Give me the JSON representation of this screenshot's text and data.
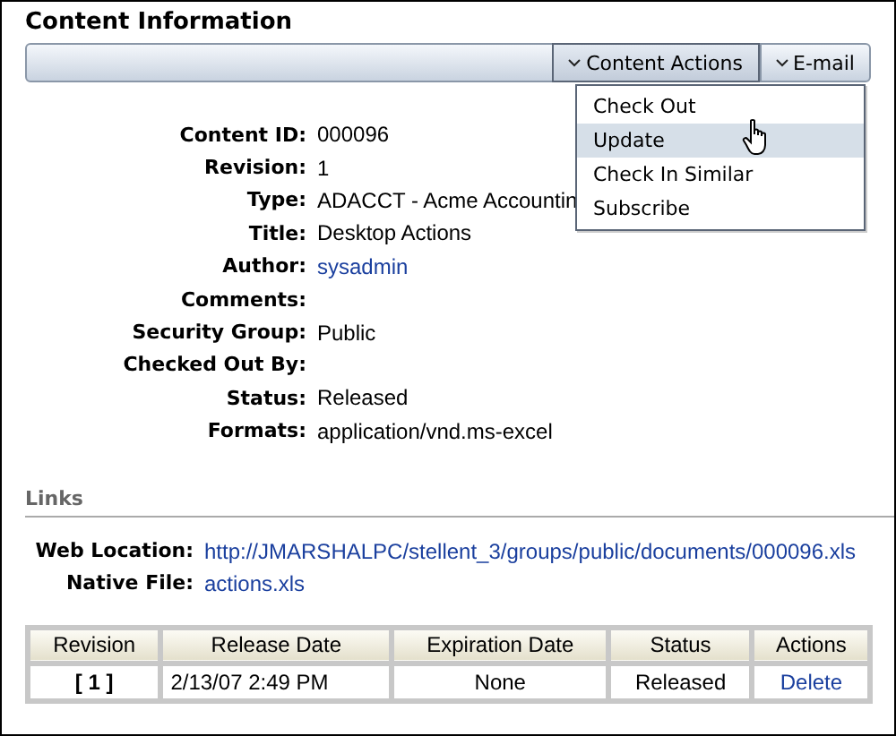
{
  "title": "Content Information",
  "toolbar": {
    "buttons": [
      {
        "label": "Content Actions",
        "selected": true
      },
      {
        "label": "E-mail",
        "selected": false
      }
    ]
  },
  "menu": {
    "items": [
      {
        "label": "Check Out",
        "selected": false
      },
      {
        "label": "Update",
        "selected": true
      },
      {
        "label": "Check In Similar",
        "selected": false
      },
      {
        "label": "Subscribe",
        "selected": false
      }
    ]
  },
  "fields": [
    {
      "label": "Content ID:",
      "value": "000096",
      "kind": "text"
    },
    {
      "label": "Revision:",
      "value": "1",
      "kind": "text"
    },
    {
      "label": "Type:",
      "value": "ADACCT - Acme Accountin",
      "kind": "text"
    },
    {
      "label": "Title:",
      "value": "Desktop Actions",
      "kind": "text"
    },
    {
      "label": "Author:",
      "value": "sysadmin",
      "kind": "link"
    },
    {
      "label": "Comments:"
    },
    {
      "label": "Security Group:",
      "value": "Public",
      "kind": "text"
    },
    {
      "label": "Checked Out By:"
    },
    {
      "label": "Status:",
      "value": "Released",
      "kind": "text"
    },
    {
      "label": "Formats:",
      "value": "application/vnd.ms-excel",
      "kind": "text"
    }
  ],
  "links": {
    "heading": "Links",
    "items": [
      {
        "label": "Web Location:",
        "value": "http://JMARSHALPC/stellent_3/groups/public/documents/000096.xls"
      },
      {
        "label": "Native File:",
        "value": "actions.xls"
      }
    ]
  },
  "table": {
    "columns": [
      "Revision",
      "Release Date",
      "Expiration Date",
      "Status",
      "Actions"
    ],
    "rows": [
      [
        {
          "text": "[ 1 ]",
          "kind": "bold"
        },
        {
          "text": "2/13/07 2:49 PM",
          "kind": "left"
        },
        {
          "text": "None",
          "kind": "text"
        },
        {
          "text": "Released",
          "kind": "text"
        },
        {
          "text": "Delete",
          "kind": "link"
        }
      ]
    ]
  }
}
